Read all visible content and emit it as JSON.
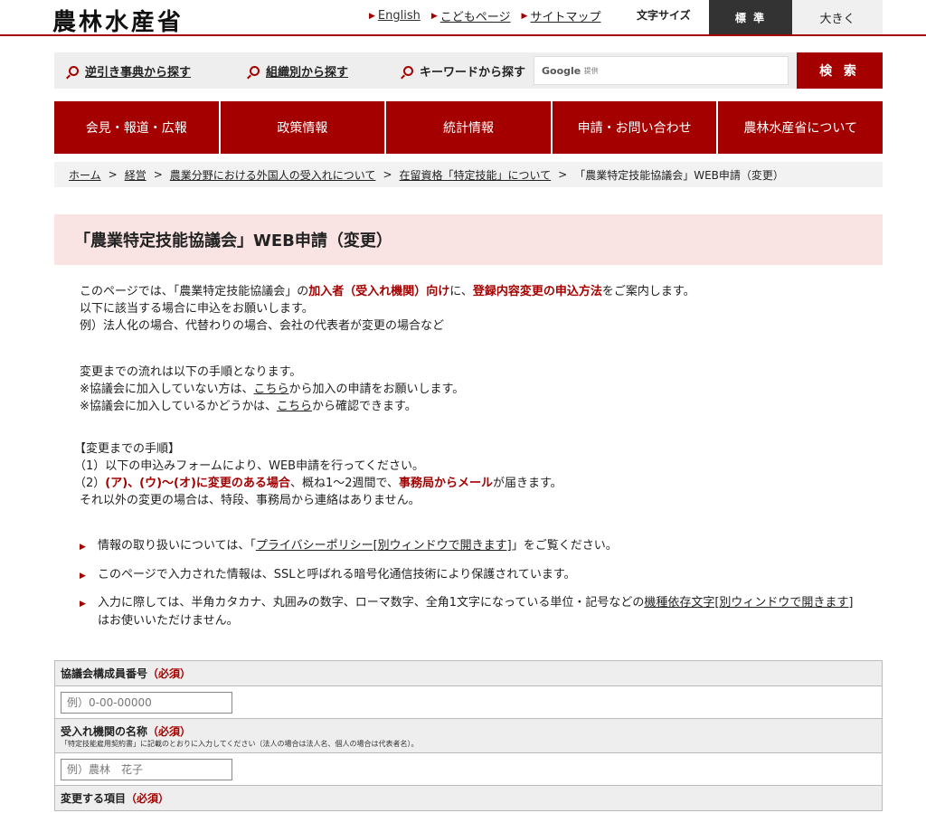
{
  "header": {
    "logo": "農林水産省",
    "links": [
      "English",
      "こどもページ",
      "サイトマップ"
    ],
    "font_size_label": "文字サイズ",
    "font_size_standard": "標 準",
    "font_size_large": "大きく"
  },
  "search": {
    "reverse_lookup": "逆引き事典から探す",
    "by_org": "組織別から探す",
    "by_keyword": "キーワードから探す",
    "google_label": "Google",
    "google_sub": "提供",
    "button": "検 索"
  },
  "nav": [
    "会見・報道・広報",
    "政策情報",
    "統計情報",
    "申請・お問い合わせ",
    "農林水産省について"
  ],
  "breadcrumb": [
    "ホーム",
    "経営",
    "農業分野における外国人の受入れについて",
    "在留資格「特定技能」について",
    "「農業特定技能協議会」WEB申請（変更）"
  ],
  "breadcrumb_sep": ">",
  "page_title": "「農業特定技能協議会」WEB申請（変更）",
  "intro": {
    "l1_a": "このページでは、「農業特定技能協議会」の",
    "l1_b": "加入者（受入れ機関）向け",
    "l1_c": "に、",
    "l1_d": "登録内容変更の申込方法",
    "l1_e": "をご案内します。",
    "l2": "以下に該当する場合に申込をお願いします。",
    "l3": "例）法人化の場合、代替わりの場合、会社の代表者が変更の場合など"
  },
  "flow": {
    "l1": "変更までの流れは以下の手順となります。",
    "l2_a": "※協議会に加入していない方は、",
    "l2_link": "こちら",
    "l2_b": "から加入の申請をお願いします。",
    "l3_a": "※協議会に加入しているかどうかは、",
    "l3_link": "こちら",
    "l3_b": "から確認できます。"
  },
  "steps": {
    "head": "【変更までの手順】",
    "s1": "（1）以下の申込みフォームにより、WEB申請を行ってください。",
    "s2_a": "（2）",
    "s2_b": "(ア)、(ウ)～(オ)に変更のある場合",
    "s2_c": "、概ね1～2週間で、",
    "s2_d": "事務局からメール",
    "s2_e": "が届きます。",
    "s3": "それ以外の変更の場合は、特段、事務局から連絡はありません。"
  },
  "bullets": {
    "b1_a": "情報の取り扱いについては、「",
    "b1_link": "プライバシーポリシー[別ウィンドウで開きます]",
    "b1_b": "」をご覧ください。",
    "b2": "このページで入力された情報は、SSLと呼ばれる暗号化通信技術により保護されています。",
    "b3_a": "入力に際しては、半角カタカナ、丸囲みの数字、ローマ数字、全角1文字になっている単位・記号などの",
    "b3_link": "機種依存文字[別ウィンドウで開きます]",
    "b3_b": "はお使いいただけません。"
  },
  "form": {
    "required": "（必須）",
    "f1_label": "協議会構成員番号",
    "f1_placeholder": "例）0-00-00000",
    "f2_label": "受入れ機関の名称",
    "f2_note": "「特定技能雇用契約書」に記載のとおりに入力してください（法人の場合は法人名、個人の場合は代表者名）。",
    "f2_placeholder": "例）農林　花子",
    "f3_label": "変更する項目"
  }
}
